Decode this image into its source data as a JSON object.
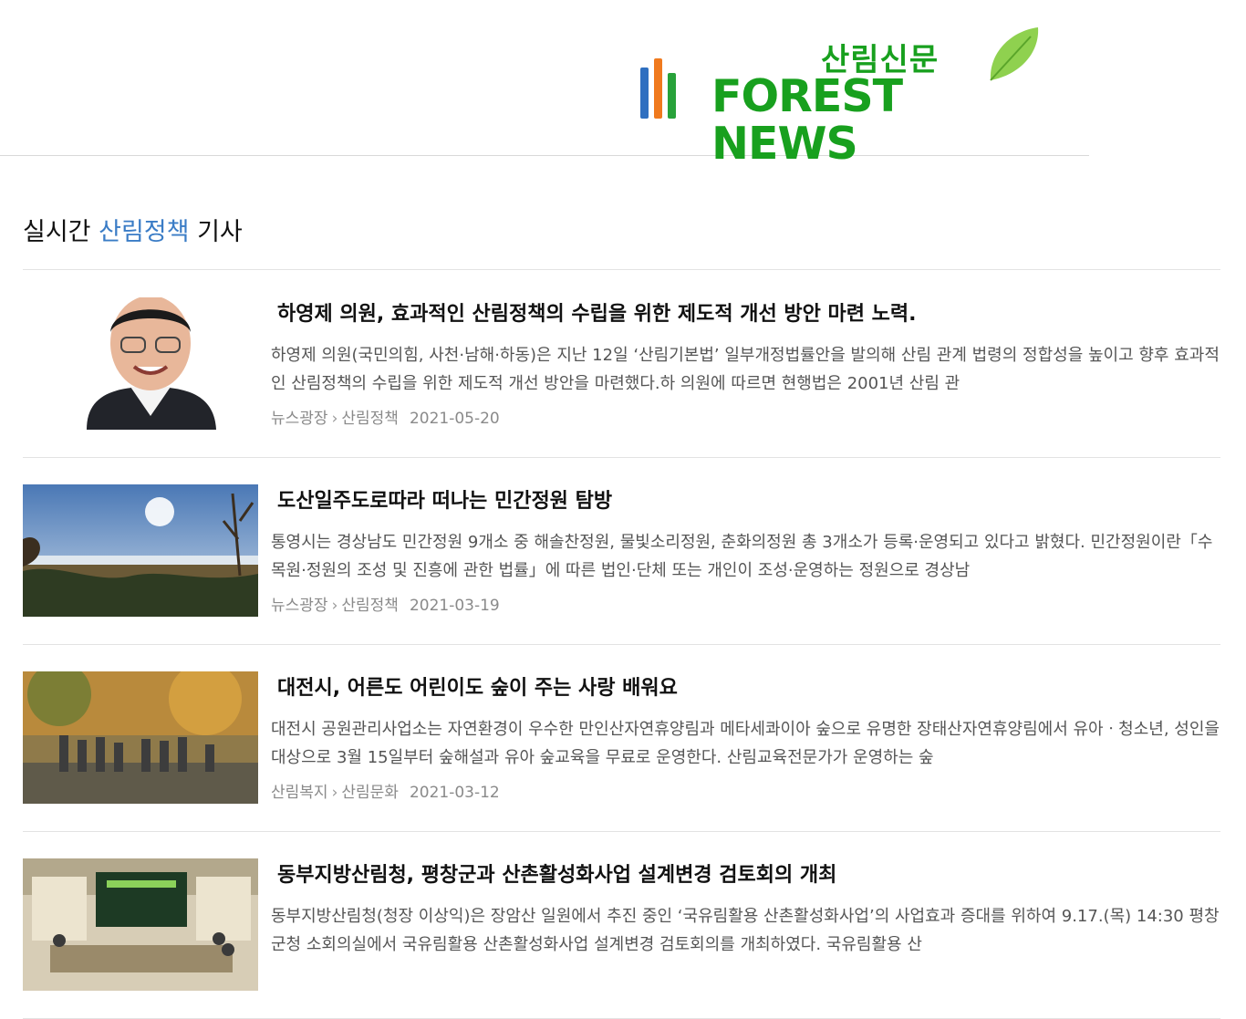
{
  "brand": {
    "kor": "산림신문",
    "eng": "FOREST NEWS",
    "colors": {
      "green": "#18a01e",
      "bar_blue": "#2f6fc0",
      "bar_orange": "#f07a1e",
      "bar_green": "#28a23a"
    }
  },
  "section": {
    "title_prefix": "실시간 ",
    "title_accent": "산림정책",
    "title_suffix": " 기사",
    "accent_color": "#3a7cc6"
  },
  "articles": [
    {
      "title": "하영제 의원, 효과적인 산림정책의 수립을 위한 제도적 개선 방안 마련 노력.",
      "summary": "  하영제 의원(국민의힘, 사천·남해·하동)은 지난 12일 ‘산림기본법’ 일부개정법률안을 발의해 산림 관계 법령의 정합성을 높이고 향후 효과적인 산림정책의 수립을 위한 제도적 개선 방안을 마련했다.하 의원에 따르면 현행법은 2001년 산림 관",
      "category": "뉴스광장",
      "subcategory": "산림정책",
      "date": "2021-05-20",
      "thumb": "portrait"
    },
    {
      "title": "도산일주도로따라 떠나는 민간정원 탐방",
      "summary": " 통영시는 경상남도 민간정원 9개소 중 해솔찬정원, 물빛소리정원, 춘화의정원 총 3개소가 등록·운영되고 있다고 밝혔다. 민간정원이란「수목원·정원의 조성 및 진흥에 관한 법률」에 따른 법인·단체 또는 개인이 조성·운영하는 정원으로 경상남",
      "category": "뉴스광장",
      "subcategory": "산림정책",
      "date": "2021-03-19",
      "thumb": "landscape"
    },
    {
      "title": "대전시, 어른도 어린이도 숲이 주는 사랑 배워요",
      "summary": "대전시 공원관리사업소는 자연환경이 우수한 만인산자연휴양림과 메타세콰이아 숲으로 유명한 장태산자연휴양림에서 유아ㆍ청소년, 성인을 대상으로 3월 15일부터 숲해설과 유아 숲교육을 무료로 운영한다. 산림교육전문가가 운영하는 숲",
      "category": "산림복지",
      "subcategory": "산림문화",
      "date": "2021-03-12",
      "thumb": "forest"
    },
    {
      "title": "동부지방산림청, 평창군과 산촌활성화사업 설계변경 검토회의 개최",
      "summary": "동부지방산림청(청장 이상익)은 장암산 일원에서 추진 중인 ‘국유림활용 산촌활성화사업’의 사업효과 증대를 위하여 9.17.(목) 14:30 평창군청 소회의실에서 국유림활용 산촌활성화사업 설계변경 검토회의를 개최하였다. 국유림활용 산",
      "category": "",
      "subcategory": "",
      "date": "",
      "thumb": "meeting"
    }
  ]
}
